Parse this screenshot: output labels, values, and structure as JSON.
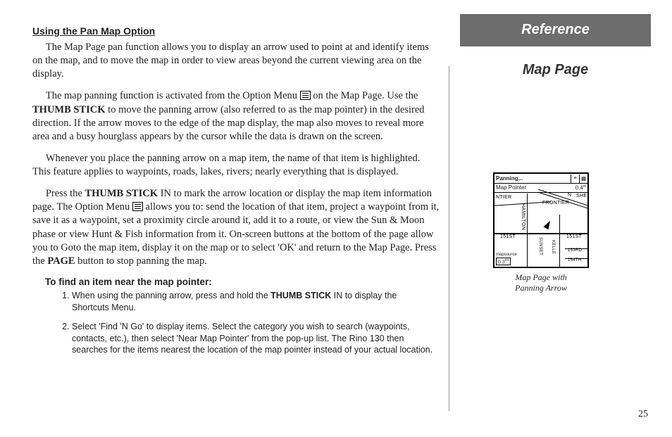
{
  "heading": "Using the Pan Map Option",
  "para1_a": "The Map Page pan function allows you to display an arrow used to point at and identify items on the map, and to move the map in order to view areas beyond the current viewing area on the display.",
  "para2_a": "The map panning function is activated from the Option Menu ",
  "para2_b": " on the Map Page.  Use the ",
  "thumb_stick": "THUMB STICK",
  "para2_c": " to move the panning arrow (also referred to as the map pointer) in the desired direction.  If the arrow moves to the edge of the map display, the map also moves to reveal more area and a busy hourglass appears by the cursor while the data is drawn on the screen.",
  "para3": "Whenever you place the panning arrow on a map item, the name of that item is highlighted. This feature applies to waypoints, roads, lakes, rivers; nearly everything that is displayed.",
  "para4_a": "Press the ",
  "para4_b": " IN to mark the arrow location or display the map item information page.  The Option Menu ",
  "para4_c": " allows you to: send the location of that item, project a waypoint from it, save it as a waypoint, set a proximity circle around it, add it to a route, or view the Sun & Moon phase or view Hunt & Fish information from it.  On-screen buttons at the bottom of the page allow you to Goto the map item, display it on the map or to select 'OK' and return to the Map Page.  Press the ",
  "page_btn": "PAGE",
  "para4_d": " button to stop panning the map.",
  "sub_heading": "To find an item near the map pointer:",
  "step1_a": "When using the panning arrow, press and hold the ",
  "step1_b": " IN to display the Shortcuts Menu.",
  "step2": "Select 'Find 'N Go' to display items.  Select  the category you wish to search (waypoints, contacts, etc.), then select 'Near Map Pointer' from the pop-up list.  The Rino 130 then searches for the items nearest the location of the map pointer instead of your actual location.",
  "ref_banner": "Reference",
  "ref_subtitle": "Map Page",
  "figure_caption_l1": "Map Page with",
  "figure_caption_l2": "Panning Arrow",
  "page_number": "25",
  "map": {
    "title": "Panning...",
    "sub_left": "Map Pointer",
    "sub_right": "0.4",
    "scale": "0.3",
    "src": "mapsource",
    "labels": {
      "ntier": "NTIER",
      "frontier": "FRONTIER",
      "hamilton": "HAMILTON",
      "st151_l": "151ST",
      "st151_r": "151ST",
      "sunset": "SUNSET",
      "kelle": "KELLE",
      "st153": "153RD",
      "st154": "154TH",
      "n": "N",
      "she": "SHE"
    }
  }
}
